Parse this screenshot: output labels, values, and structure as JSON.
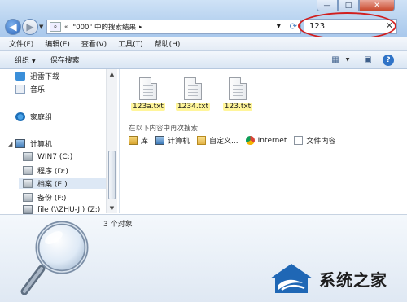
{
  "window_controls": {
    "minimize": "—",
    "maximize": "□",
    "close": "✕"
  },
  "address_bar": {
    "crumb_prefix": "«",
    "location": "\"000\" 中的搜索结果",
    "separator": "▸"
  },
  "search_box": {
    "value": "123"
  },
  "menu": [
    "文件(F)",
    "编辑(E)",
    "查看(V)",
    "工具(T)",
    "帮助(H)"
  ],
  "toolbar": {
    "organize": "组织",
    "save_search": "保存搜索"
  },
  "nav_pane": {
    "favorites": [
      {
        "label": "迅雷下载",
        "icon": "thunder-download-icon"
      },
      {
        "label": "音乐",
        "icon": "music-icon"
      }
    ],
    "homegroup": {
      "label": "家庭组",
      "icon": "homegroup-icon"
    },
    "computer": {
      "label": "计算机",
      "icon": "computer-icon"
    },
    "drives": [
      {
        "label": "WIN7 (C:)",
        "icon": "system-drive-icon"
      },
      {
        "label": "程序 (D:)",
        "icon": "drive-icon"
      },
      {
        "label": "档案 (E:)",
        "icon": "drive-icon"
      },
      {
        "label": "备份 (F:)",
        "icon": "drive-icon"
      },
      {
        "label": "file (\\\\ZHU-JI) (Z:)",
        "icon": "network-drive-icon"
      }
    ]
  },
  "results": [
    {
      "name": "123a.txt",
      "icon": "text-file-icon"
    },
    {
      "name": "1234.txt",
      "icon": "text-file-icon"
    },
    {
      "name": "123.txt",
      "icon": "text-file-icon"
    }
  ],
  "search_again": {
    "heading": "在以下内容中再次搜索:",
    "targets": [
      {
        "label": "库",
        "icon": "library-icon"
      },
      {
        "label": "计算机",
        "icon": "computer-icon"
      },
      {
        "label": "自定义...",
        "icon": "folder-icon"
      },
      {
        "label": "Internet",
        "icon": "internet-icon"
      },
      {
        "label": "文件内容",
        "icon": "file-content-icon"
      }
    ]
  },
  "status": {
    "item_count": "3 个对象"
  },
  "watermark": {
    "text": "系统之家"
  },
  "colors": {
    "highlight": "#fff59a",
    "annotation_ring": "#d11e1e",
    "accent": "#2f73c7"
  }
}
